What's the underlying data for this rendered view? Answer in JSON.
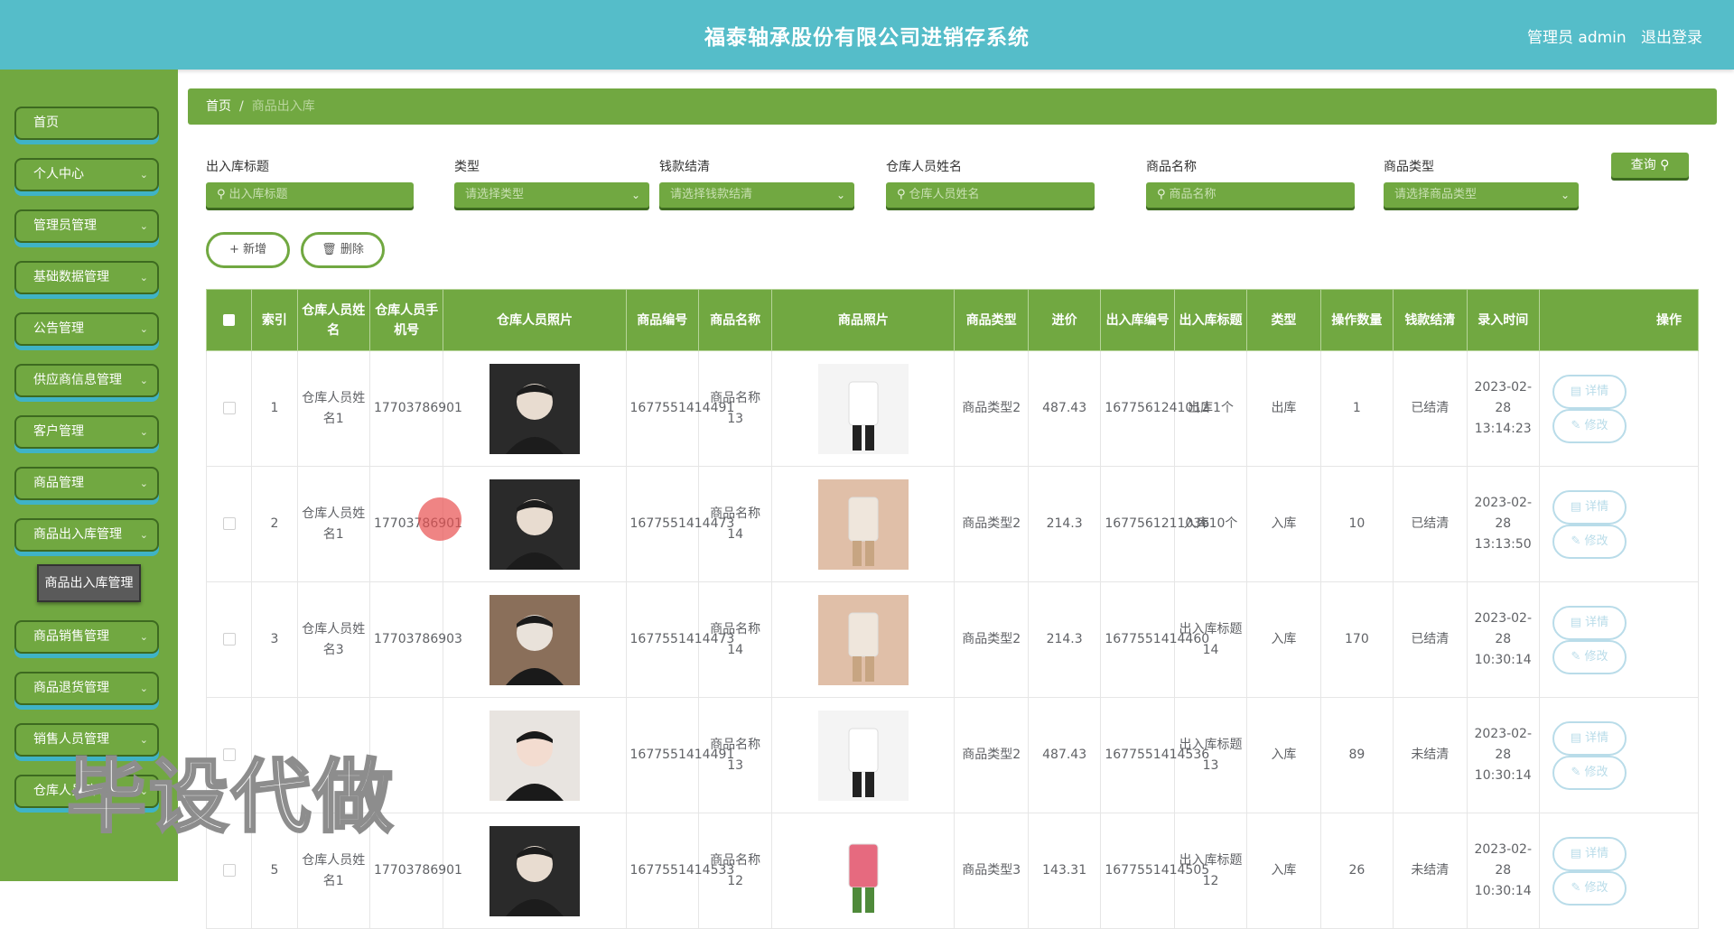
{
  "header": {
    "title": "福泰轴承股份有限公司进销存系统",
    "user": "管理员 admin",
    "logout": "退出登录"
  },
  "sidebar": {
    "items": [
      {
        "label": "首页"
      },
      {
        "label": "个人中心"
      },
      {
        "label": "管理员管理"
      },
      {
        "label": "基础数据管理"
      },
      {
        "label": "公告管理"
      },
      {
        "label": "供应商信息管理"
      },
      {
        "label": "客户管理"
      },
      {
        "label": "商品管理"
      },
      {
        "label": "商品出入库管理"
      },
      {
        "label": "商品销售管理"
      },
      {
        "label": "商品退货管理"
      },
      {
        "label": "销售人员管理"
      },
      {
        "label": "仓库人员管理"
      }
    ],
    "submenu": "商品出入库管理"
  },
  "breadcrumb": {
    "home": "首页",
    "sep": "/",
    "current": "商品出入库"
  },
  "filters": {
    "title": {
      "label": "出入库标题",
      "placeholder": "出入库标题"
    },
    "type": {
      "label": "类型",
      "placeholder": "请选择类型"
    },
    "settle": {
      "label": "钱款结清",
      "placeholder": "请选择钱款结清"
    },
    "staff": {
      "label": "仓库人员姓名",
      "placeholder": "仓库人员姓名"
    },
    "goods": {
      "label": "商品名称",
      "placeholder": "商品名称"
    },
    "goodstype": {
      "label": "商品类型",
      "placeholder": "请选择商品类型"
    },
    "query": "查询"
  },
  "actions": {
    "add": "新增",
    "delete": "删除"
  },
  "table": {
    "headers": [
      "索引",
      "仓库人员姓名",
      "仓库人员手机号",
      "仓库人员照片",
      "商品编号",
      "商品名称",
      "商品照片",
      "商品类型",
      "进价",
      "出入库编号",
      "出入库标题",
      "类型",
      "操作数量",
      "钱款结清",
      "录入时间",
      "操作"
    ],
    "detail_label": "详情",
    "edit_label": "修改",
    "rows": [
      {
        "idx": "1",
        "name": "仓库人员姓名1",
        "phone": "17703786901",
        "code": "1677551414491",
        "goods": "商品名称13",
        "gtype": "商品类型2",
        "price": "487.43",
        "no": "1677561241012",
        "title": "出库1个",
        "type": "出库",
        "qty": "1",
        "settle": "已结清",
        "time": "2023-02-28 13:14:23"
      },
      {
        "idx": "2",
        "name": "仓库人员姓名1",
        "phone": "17703786901",
        "code": "1677551414473",
        "goods": "商品名称14",
        "gtype": "商品类型2",
        "price": "214.3",
        "no": "1677561211036",
        "title": "入库10个",
        "type": "入库",
        "qty": "10",
        "settle": "已结清",
        "time": "2023-02-28 13:13:50"
      },
      {
        "idx": "3",
        "name": "仓库人员姓名3",
        "phone": "17703786903",
        "code": "1677551414473",
        "goods": "商品名称14",
        "gtype": "商品类型2",
        "price": "214.3",
        "no": "1677551414460",
        "title": "出入库标题14",
        "type": "入库",
        "qty": "170",
        "settle": "已结清",
        "time": "2023-02-28 10:30:14"
      },
      {
        "idx": "",
        "name": "",
        "phone": "",
        "code": "1677551414491",
        "goods": "商品名称13",
        "gtype": "商品类型2",
        "price": "487.43",
        "no": "1677551414536",
        "title": "出入库标题13",
        "type": "入库",
        "qty": "89",
        "settle": "未结清",
        "time": "2023-02-28 10:30:14"
      },
      {
        "idx": "5",
        "name": "仓库人员姓名1",
        "phone": "17703786901",
        "code": "1677551414533",
        "goods": "商品名称12",
        "gtype": "商品类型3",
        "price": "143.31",
        "no": "1677551414505",
        "title": "出入库标题12",
        "type": "入库",
        "qty": "26",
        "settle": "未结清",
        "time": "2023-02-28 10:30:14"
      }
    ]
  },
  "watermark": "毕设代做",
  "colors": {
    "header": "#55bdc9",
    "sidebar": "#71a841",
    "accent": "#71a841"
  }
}
